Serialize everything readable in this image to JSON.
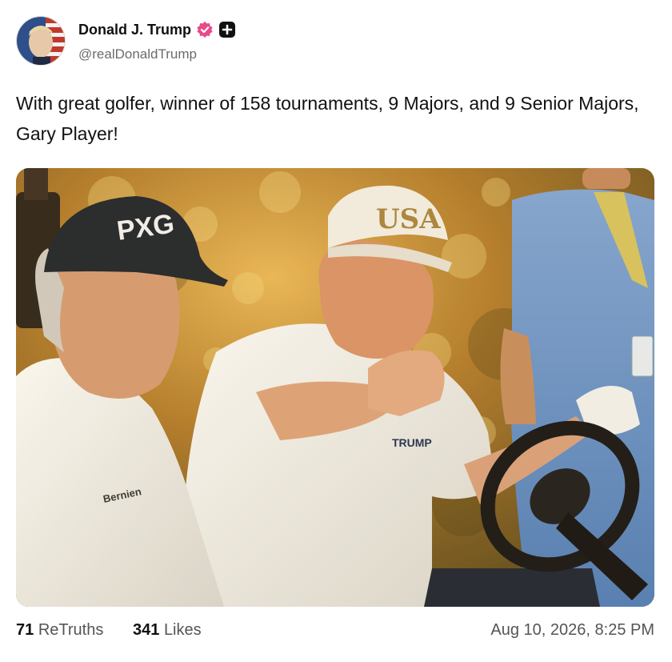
{
  "post": {
    "author_name": "Donald J. Trump",
    "author_handle": "@realDonaldTrump",
    "text": "With great golfer, winner of 158 tournaments, 9 Majors, and 9 Senior Majors, Gary Player!",
    "verified_badge_color": "#e84a8a",
    "image_alt": "",
    "retruths_count": "71",
    "retruths_label": "ReTruths",
    "likes_count": "341",
    "likes_label": "Likes",
    "timestamp": "Aug 10, 2026, 8:25 PM"
  },
  "image_text": {
    "cap_left": "PXG",
    "cap_right": "USA",
    "shirt_right": "TRUMP",
    "shirt_left": "Bernien"
  },
  "icons": [
    "verified-badge-icon",
    "plus-badge-icon"
  ]
}
